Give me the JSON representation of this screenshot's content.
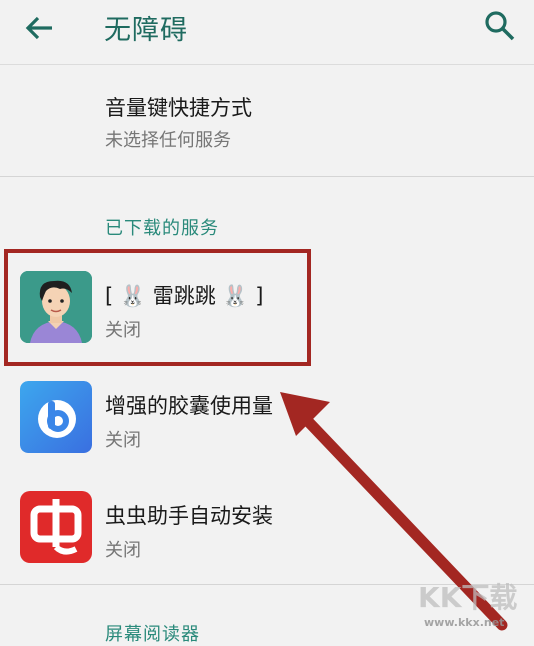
{
  "appbar": {
    "title": "无障碍",
    "back_icon": "arrow-left-icon",
    "search_icon": "search-icon"
  },
  "shortcut": {
    "title": "音量键快捷方式",
    "subtitle": "未选择任何服务"
  },
  "downloaded_section": {
    "header": "已下载的服务",
    "items": [
      {
        "title": "[ 🐰 雷跳跳 🐰 ]",
        "status": "关闭",
        "icon": "avatar-man-icon"
      },
      {
        "title": "增强的胶囊使用量",
        "status": "关闭",
        "icon": "bixby-b-icon"
      },
      {
        "title": "虫虫助手自动安装",
        "status": "关闭",
        "icon": "chongchong-icon"
      }
    ]
  },
  "next_section": {
    "header": "屏幕阅读器"
  },
  "watermark": {
    "logo": "KK下载",
    "url": "www.kkx.net"
  },
  "colors": {
    "accent": "#1f6b60",
    "section": "#2a8a7b",
    "highlight": "#a32722"
  }
}
